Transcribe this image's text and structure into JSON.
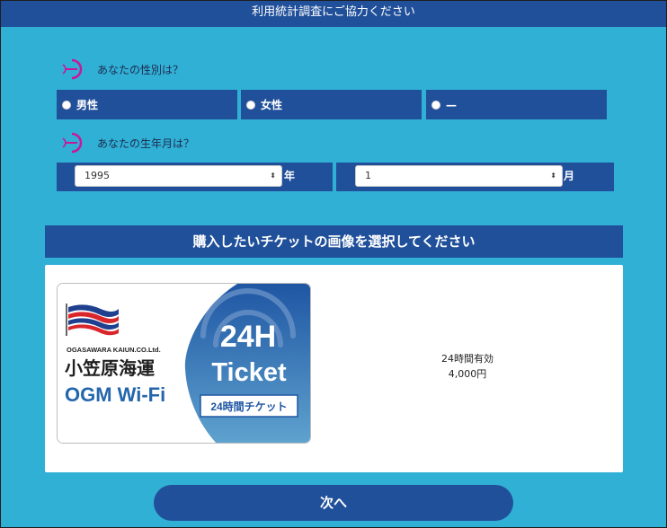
{
  "header": {
    "title": "利用統計調査にご協力ください"
  },
  "gender": {
    "question": "あなたの性別は？",
    "options": [
      "男性",
      "女性",
      "—"
    ]
  },
  "birth": {
    "question": "あなたの生年月は？",
    "year_value": "1995",
    "year_unit": "年",
    "month_value": "1",
    "month_unit": "月"
  },
  "ticket_section": {
    "heading": "購入したいチケットの画像を選択してください",
    "ticket": {
      "company_en": "OGASAWARA KAIUN.CO.Ltd.",
      "company_jp": "小笠原海運",
      "product": "OGM Wi-Fi",
      "big_1": "24H",
      "big_2": "Ticket",
      "tag": "24時間チケット"
    },
    "validity": "24時間有効",
    "price": "4,000円"
  },
  "next_button": "次へ",
  "colors": {
    "navy": "#21509a",
    "sky": "#31b0d6",
    "magenta": "#c8189a",
    "ticket_blue": "#2466ad"
  },
  "icons": [
    "question-icon",
    "radio-icon",
    "select-caret-icon",
    "flag-logo-icon",
    "wifi-icon"
  ]
}
